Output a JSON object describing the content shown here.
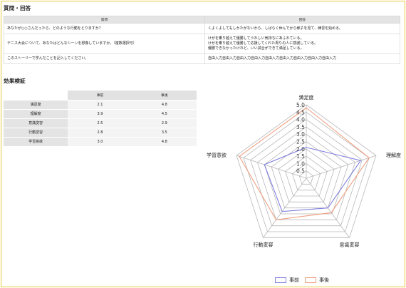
{
  "qa_section": {
    "title": "質問・回答",
    "col_question": "質問",
    "col_answer": "回答",
    "rows": [
      {
        "question": "あなたが○○さんだったら、どのような行動をとりますか？",
        "answer": [
          "くよくよしてもしかたがないから、しばらく休んでから様子を見て、練習を始める。"
        ]
      },
      {
        "question": "テニス大会について、あなたはどんなシーンを想像していますか。（複数選択可）",
        "answer": [
          "けがを乗り越えて優勝してうれしい気持ちにあふれている。",
          "けがを乗り越えて優勝して応援してくれた周りの人に感謝している。",
          "優勝できなかったけれど、いい試合ができて満足している。"
        ]
      },
      {
        "question": "このストーリーで学んだことを記入してください。",
        "answer": [
          "自由入力自由入力自由入力自由入力自由入力自由入力自由入力自由入力自由入力"
        ]
      }
    ]
  },
  "eval_section": {
    "title": "効果検証",
    "col_before": "事前",
    "col_after": "事後",
    "rows": [
      {
        "label": "満足度",
        "before": "2.1",
        "after": "4.8"
      },
      {
        "label": "理解度",
        "before": "3.9",
        "after": "4.5"
      },
      {
        "label": "意識変容",
        "before": "2.5",
        "after": "2.9"
      },
      {
        "label": "行動変容",
        "before": "2.8",
        "after": "3.5"
      },
      {
        "label": "学習意欲",
        "before": "3.0",
        "after": "4.8"
      }
    ]
  },
  "chart_data": {
    "type": "radar",
    "axes": [
      "満足度",
      "理解度",
      "意識変容",
      "行動変容",
      "学習意欲"
    ],
    "ticks": [
      "0.5",
      "1.0",
      "1.5",
      "2.0",
      "2.5",
      "3.0",
      "3.5",
      "4.0",
      "4.5",
      "5.0"
    ],
    "rlim": [
      0,
      5
    ],
    "series": [
      {
        "name": "事前",
        "values": [
          2.1,
          3.9,
          2.5,
          2.8,
          3.0
        ],
        "color": "#8080e0"
      },
      {
        "name": "事後",
        "values": [
          4.8,
          4.5,
          2.9,
          3.5,
          4.8
        ],
        "color": "#f0a080"
      }
    ],
    "legend_position": "bottom"
  }
}
